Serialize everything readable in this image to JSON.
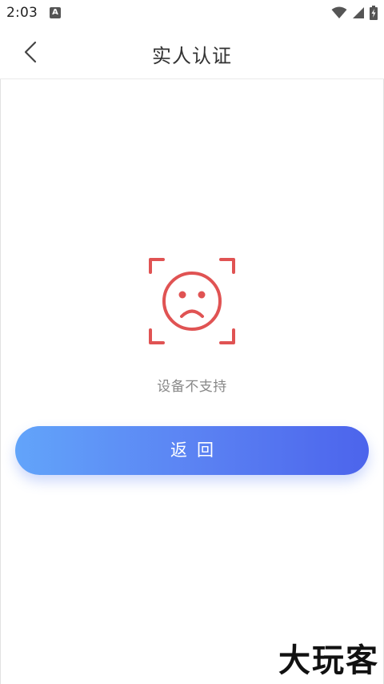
{
  "status_bar": {
    "time": "2:03",
    "icons": [
      "a-notification-icon",
      "wifi-icon",
      "signal-icon",
      "battery-icon"
    ]
  },
  "header": {
    "title": "实人认证",
    "back_icon": "chevron-left-icon"
  },
  "main": {
    "icon": "sad-face-icon",
    "icon_color": "#e05353",
    "message": "设备不支持",
    "button_label": "返回"
  },
  "watermark": "大玩客",
  "colors": {
    "button_gradient_start": "#62a4fa",
    "button_gradient_end": "#4c64ec"
  }
}
